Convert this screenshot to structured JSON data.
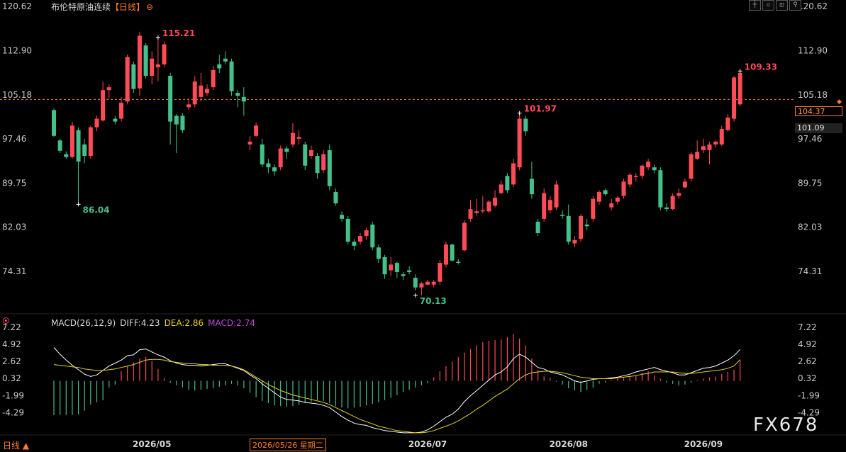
{
  "header": {
    "symbol": "布伦特原油连续",
    "period": "【日线】",
    "settings_icon": "gear-icon",
    "window_buttons": [
      "crosshair-icon",
      "minimize-icon",
      "fit-icon",
      "pin-icon"
    ]
  },
  "indicator": {
    "name": "MACD(26,12,9)",
    "diff": "DIFF:4.23",
    "dea": "DEA:2.86",
    "macd": "MACD:2.74"
  },
  "timeframe_button": "日线 ▲",
  "cursor_date": "2026/05/26 星期二",
  "watermark": "FX678",
  "price_tags": {
    "current": "104.37",
    "previous": "101.09"
  },
  "colors": {
    "up": "#ff4b55",
    "down": "#46c08a",
    "diff_line": "#ffffff",
    "dea_line": "#e6d21e",
    "macd_label": "#c14bd8",
    "accent": "#ff7d2a"
  },
  "chart_data": {
    "type": "candlestick",
    "title": "布伦特原油连续【日线】",
    "price_ticks": [
      120.62,
      112.9,
      105.18,
      97.46,
      89.75,
      82.03,
      74.31
    ],
    "price_tick_labels": [
      "120.62",
      "112.90",
      "105.18",
      "97.46",
      "89.75",
      "82.03",
      "74.31"
    ],
    "price_range": [
      68.5,
      121.5
    ],
    "reference_price": 104.37,
    "x_labels": [
      {
        "index": 16,
        "label": "2026/05"
      },
      {
        "index": 61,
        "label": "2026/07"
      },
      {
        "index": 84,
        "label": "2026/08"
      },
      {
        "index": 106,
        "label": "2026/09"
      }
    ],
    "annotations": [
      {
        "index": 17,
        "price": 115.21,
        "label": "115.21",
        "kind": "high"
      },
      {
        "index": 4,
        "price": 86.04,
        "label": "86.04",
        "kind": "low"
      },
      {
        "index": 59,
        "price": 70.13,
        "label": "70.13",
        "kind": "low"
      },
      {
        "index": 76,
        "price": 101.97,
        "label": "101.97",
        "kind": "high"
      },
      {
        "index": 112,
        "price": 109.33,
        "label": "109.33",
        "kind": "high"
      }
    ],
    "ohlc": [
      [
        102.5,
        102.8,
        97.8,
        98.0
      ],
      [
        97.2,
        97.5,
        95.0,
        95.4
      ],
      [
        94.8,
        95.3,
        94.0,
        94.3
      ],
      [
        94.3,
        100.5,
        94.0,
        99.8
      ],
      [
        99.0,
        99.5,
        86.04,
        93.5
      ],
      [
        96.5,
        97.5,
        93.2,
        94.5
      ],
      [
        94.5,
        99.8,
        94.0,
        99.5
      ],
      [
        99.5,
        101.5,
        98.8,
        101.0
      ],
      [
        100.7,
        107.5,
        100.5,
        106.0
      ],
      [
        106.0,
        107.0,
        104.5,
        106.5
      ],
      [
        101.0,
        101.5,
        100.0,
        100.5
      ],
      [
        101.0,
        104.8,
        100.5,
        103.8
      ],
      [
        104.0,
        112.2,
        103.5,
        111.8
      ],
      [
        110.5,
        111.0,
        105.5,
        106.2
      ],
      [
        106.3,
        116.2,
        105.0,
        115.5
      ],
      [
        113.8,
        114.2,
        108.0,
        108.5
      ],
      [
        108.5,
        112.8,
        107.0,
        111.5
      ],
      [
        110.0,
        115.21,
        107.5,
        110.5
      ],
      [
        110.5,
        114.5,
        110.0,
        114.0
      ],
      [
        108.5,
        109.0,
        96.5,
        100.5
      ],
      [
        101.5,
        101.8,
        95.0,
        100.0
      ],
      [
        101.5,
        102.0,
        98.5,
        99.0
      ],
      [
        103.0,
        104.5,
        102.5,
        103.5
      ],
      [
        103.5,
        108.5,
        103.0,
        107.5
      ],
      [
        104.8,
        109.0,
        104.0,
        106.8
      ],
      [
        105.5,
        107.0,
        105.0,
        106.2
      ],
      [
        106.5,
        110.2,
        106.0,
        109.5
      ],
      [
        110.5,
        112.2,
        109.0,
        109.8
      ],
      [
        111.5,
        112.8,
        110.5,
        111.0
      ],
      [
        111.0,
        111.5,
        105.0,
        105.8
      ],
      [
        105.5,
        106.0,
        103.0,
        105.0
      ],
      [
        104.8,
        106.5,
        101.5,
        104.0
      ],
      [
        96.5,
        98.0,
        95.5,
        97.0
      ],
      [
        98.0,
        100.3,
        97.8,
        99.8
      ],
      [
        96.5,
        97.5,
        92.5,
        93.0
      ],
      [
        93.2,
        94.0,
        91.5,
        92.5
      ],
      [
        92.5,
        93.0,
        91.0,
        91.8
      ],
      [
        92.5,
        96.3,
        92.0,
        95.8
      ],
      [
        95.8,
        96.2,
        94.0,
        95.2
      ],
      [
        96.5,
        100.2,
        96.0,
        98.5
      ],
      [
        97.5,
        99.0,
        96.5,
        97.8
      ],
      [
        96.5,
        97.0,
        92.0,
        92.8
      ],
      [
        94.5,
        96.3,
        94.0,
        95.5
      ],
      [
        94.5,
        95.0,
        90.5,
        91.5
      ],
      [
        92.0,
        95.5,
        91.5,
        94.8
      ],
      [
        95.5,
        96.5,
        88.5,
        89.2
      ],
      [
        88.2,
        88.8,
        85.8,
        86.2
      ],
      [
        84.2,
        84.8,
        83.0,
        83.5
      ],
      [
        83.5,
        84.0,
        79.0,
        79.5
      ],
      [
        79.5,
        80.0,
        78.0,
        78.8
      ],
      [
        79.5,
        81.0,
        79.0,
        80.5
      ],
      [
        80.5,
        82.0,
        79.8,
        81.5
      ],
      [
        82.5,
        83.0,
        78.0,
        78.5
      ],
      [
        78.5,
        79.0,
        75.8,
        76.5
      ],
      [
        76.8,
        77.2,
        73.0,
        73.8
      ],
      [
        74.5,
        76.8,
        73.5,
        75.5
      ],
      [
        75.8,
        76.0,
        73.2,
        74.2
      ],
      [
        73.8,
        74.2,
        72.8,
        73.5
      ],
      [
        74.5,
        75.2,
        73.8,
        74.2
      ],
      [
        73.2,
        73.8,
        71.0,
        71.5
      ],
      [
        71.5,
        72.5,
        70.13,
        72.2
      ],
      [
        72.0,
        72.8,
        71.8,
        72.5
      ],
      [
        72.0,
        72.8,
        71.5,
        72.5
      ],
      [
        72.5,
        76.3,
        72.0,
        75.8
      ],
      [
        75.5,
        79.5,
        75.0,
        79.0
      ],
      [
        79.0,
        79.2,
        76.0,
        76.2
      ],
      [
        76.0,
        76.5,
        75.5,
        75.8
      ],
      [
        78.0,
        83.2,
        77.8,
        82.8
      ],
      [
        83.5,
        86.8,
        83.0,
        85.2
      ],
      [
        84.5,
        87.0,
        84.0,
        84.8
      ],
      [
        84.8,
        87.5,
        84.5,
        85.0
      ],
      [
        84.8,
        86.8,
        84.5,
        86.5
      ],
      [
        85.8,
        88.5,
        85.5,
        87.2
      ],
      [
        88.0,
        90.2,
        87.8,
        89.5
      ],
      [
        91.0,
        91.5,
        88.0,
        88.5
      ],
      [
        89.5,
        94.0,
        89.0,
        93.2
      ],
      [
        92.5,
        101.97,
        92.0,
        101.0
      ],
      [
        101.0,
        101.5,
        98.0,
        98.8
      ],
      [
        90.5,
        93.5,
        87.0,
        87.8
      ],
      [
        83.0,
        83.5,
        80.5,
        81.0
      ],
      [
        83.5,
        88.8,
        83.0,
        88.0
      ],
      [
        85.0,
        87.5,
        84.5,
        86.8
      ],
      [
        85.5,
        90.2,
        85.0,
        89.5
      ],
      [
        84.2,
        85.0,
        83.5,
        84.0
      ],
      [
        84.0,
        86.0,
        79.0,
        79.5
      ],
      [
        79.2,
        80.5,
        78.5,
        79.8
      ],
      [
        80.0,
        84.3,
        79.5,
        84.0
      ],
      [
        82.5,
        83.5,
        81.5,
        82.2
      ],
      [
        83.5,
        87.5,
        83.0,
        87.0
      ],
      [
        86.5,
        88.5,
        86.0,
        88.2
      ],
      [
        88.5,
        88.8,
        87.5,
        87.8
      ],
      [
        85.5,
        87.0,
        85.0,
        86.2
      ],
      [
        86.5,
        87.5,
        86.0,
        87.2
      ],
      [
        87.5,
        90.5,
        87.0,
        90.0
      ],
      [
        89.5,
        91.5,
        89.0,
        91.2
      ],
      [
        90.8,
        91.5,
        90.0,
        91.0
      ],
      [
        91.0,
        93.0,
        90.5,
        92.8
      ],
      [
        92.5,
        94.0,
        92.0,
        93.5
      ],
      [
        92.5,
        93.0,
        91.5,
        92.0
      ],
      [
        92.0,
        92.5,
        85.0,
        85.5
      ],
      [
        85.5,
        86.2,
        84.8,
        85.2
      ],
      [
        85.2,
        88.0,
        85.0,
        87.5
      ],
      [
        87.5,
        88.8,
        87.0,
        88.0
      ],
      [
        89.0,
        90.5,
        88.8,
        90.0
      ],
      [
        90.5,
        95.2,
        90.0,
        94.8
      ],
      [
        94.0,
        97.2,
        93.8,
        95.2
      ],
      [
        95.5,
        97.5,
        95.0,
        96.2
      ],
      [
        95.5,
        97.0,
        93.0,
        96.5
      ],
      [
        96.5,
        97.2,
        96.0,
        97.0
      ],
      [
        96.5,
        99.8,
        96.2,
        99.2
      ],
      [
        99.0,
        101.8,
        98.8,
        101.2
      ],
      [
        101.0,
        108.5,
        100.5,
        108.2
      ],
      [
        103.5,
        109.33,
        103.2,
        109.0
      ]
    ],
    "macd_ticks": [
      7.22,
      4.92,
      2.62,
      0.32,
      -1.99,
      -4.29
    ],
    "macd_tick_labels": [
      "7.22",
      "4.92",
      "2.62",
      "0.32",
      "-1.99",
      "-4.29"
    ],
    "macd_range": [
      -7.2,
      7.6
    ],
    "diff_values": [
      4.5,
      3.6,
      2.8,
      2.1,
      1.5,
      0.9,
      0.6,
      0.8,
      1.4,
      2.0,
      2.4,
      2.8,
      3.4,
      3.5,
      4.2,
      4.3,
      3.9,
      3.5,
      3.2,
      2.7,
      2.4,
      2.2,
      2.1,
      2.1,
      2.0,
      2.1,
      2.2,
      2.3,
      2.3,
      2.0,
      1.7,
      1.4,
      0.8,
      0.3,
      -0.4,
      -1.0,
      -1.6,
      -2.2,
      -2.5,
      -2.6,
      -2.7,
      -2.9,
      -3.0,
      -3.1,
      -3.3,
      -3.6,
      -4.2,
      -4.8,
      -5.3,
      -5.7,
      -5.9,
      -6.0,
      -6.3,
      -6.5,
      -6.7,
      -6.8,
      -6.9,
      -7.0,
      -7.0,
      -7.0,
      -6.9,
      -6.6,
      -6.1,
      -5.5,
      -4.9,
      -4.5,
      -3.8,
      -2.8,
      -2.0,
      -1.3,
      -0.6,
      0.1,
      0.8,
      1.2,
      1.9,
      3.0,
      3.6,
      3.2,
      2.5,
      1.8,
      1.6,
      1.2,
      1.0,
      0.8,
      0.4,
      0.0,
      -0.2,
      0.0,
      0.2,
      0.3,
      0.3,
      0.4,
      0.5,
      0.7,
      0.9,
      1.2,
      1.4,
      1.6,
      1.8,
      1.5,
      1.3,
      1.1,
      0.8,
      0.8,
      1.1,
      1.4,
      1.7,
      1.8,
      2.0,
      2.4,
      2.8,
      3.4,
      4.23
    ],
    "dea_values": [
      2.2,
      2.1,
      2.0,
      1.9,
      1.8,
      1.6,
      1.5,
      1.4,
      1.4,
      1.5,
      1.6,
      1.8,
      2.0,
      2.2,
      2.5,
      2.8,
      2.9,
      2.9,
      2.8,
      2.6,
      2.5,
      2.4,
      2.3,
      2.3,
      2.2,
      2.2,
      2.1,
      2.1,
      2.1,
      2.0,
      1.8,
      1.5,
      1.0,
      0.5,
      0.0,
      -0.5,
      -0.9,
      -1.3,
      -1.6,
      -1.9,
      -2.1,
      -2.3,
      -2.5,
      -2.7,
      -2.9,
      -3.2,
      -3.6,
      -4.0,
      -4.4,
      -4.8,
      -5.2,
      -5.5,
      -5.8,
      -6.1,
      -6.3,
      -6.5,
      -6.7,
      -6.8,
      -6.9,
      -7.0,
      -7.0,
      -6.9,
      -6.7,
      -6.4,
      -6.1,
      -5.8,
      -5.4,
      -4.9,
      -4.4,
      -3.8,
      -3.3,
      -2.7,
      -2.1,
      -1.6,
      -1.1,
      -0.4,
      0.3,
      0.8,
      1.1,
      1.2,
      1.3,
      1.3,
      1.2,
      1.1,
      0.9,
      0.7,
      0.5,
      0.4,
      0.3,
      0.3,
      0.3,
      0.3,
      0.4,
      0.5,
      0.6,
      0.7,
      0.9,
      1.0,
      1.2,
      1.2,
      1.2,
      1.2,
      1.1,
      1.0,
      1.0,
      1.1,
      1.2,
      1.3,
      1.4,
      1.5,
      1.7,
      2.0,
      2.86
    ],
    "macd_values": [
      -4.6,
      -4.6,
      -4.6,
      -4.6,
      -4.5,
      -4.0,
      -3.2,
      -2.9,
      -2.6,
      -0.9,
      -0.5,
      1.3,
      2.0,
      2.5,
      3.0,
      3.2,
      2.7,
      1.6,
      0.4,
      -0.3,
      -0.6,
      -0.9,
      -1.2,
      -1.3,
      -1.2,
      -1.1,
      -1.0,
      -0.8,
      -0.6,
      -0.4,
      -0.6,
      -1.0,
      -1.6,
      -2.2,
      -2.7,
      -3.0,
      -3.3,
      -3.4,
      -3.5,
      -3.4,
      -3.2,
      -3.0,
      -2.8,
      -2.6,
      -2.7,
      -3.0,
      -3.4,
      -3.6,
      -3.7,
      -3.6,
      -3.5,
      -3.3,
      -3.1,
      -2.9,
      -2.6,
      -2.3,
      -1.9,
      -1.5,
      -1.2,
      -0.9,
      -0.6,
      -0.3,
      0.5,
      1.3,
      2.0,
      2.6,
      3.2,
      3.8,
      4.3,
      4.8,
      5.2,
      5.4,
      5.5,
      5.6,
      5.9,
      6.3,
      5.7,
      4.8,
      3.0,
      1.5,
      0.6,
      0.4,
      -0.1,
      -0.5,
      -1.0,
      -1.3,
      -1.5,
      -1.2,
      -0.9,
      -0.4,
      -0.2,
      0.1,
      0.3,
      0.4,
      0.6,
      0.7,
      1.1,
      1.3,
      0.7,
      0.3,
      -0.2,
      -0.4,
      -0.6,
      -0.5,
      -0.2,
      0.1,
      0.3,
      0.5,
      0.6,
      0.9,
      1.2,
      1.5,
      2.74
    ]
  }
}
